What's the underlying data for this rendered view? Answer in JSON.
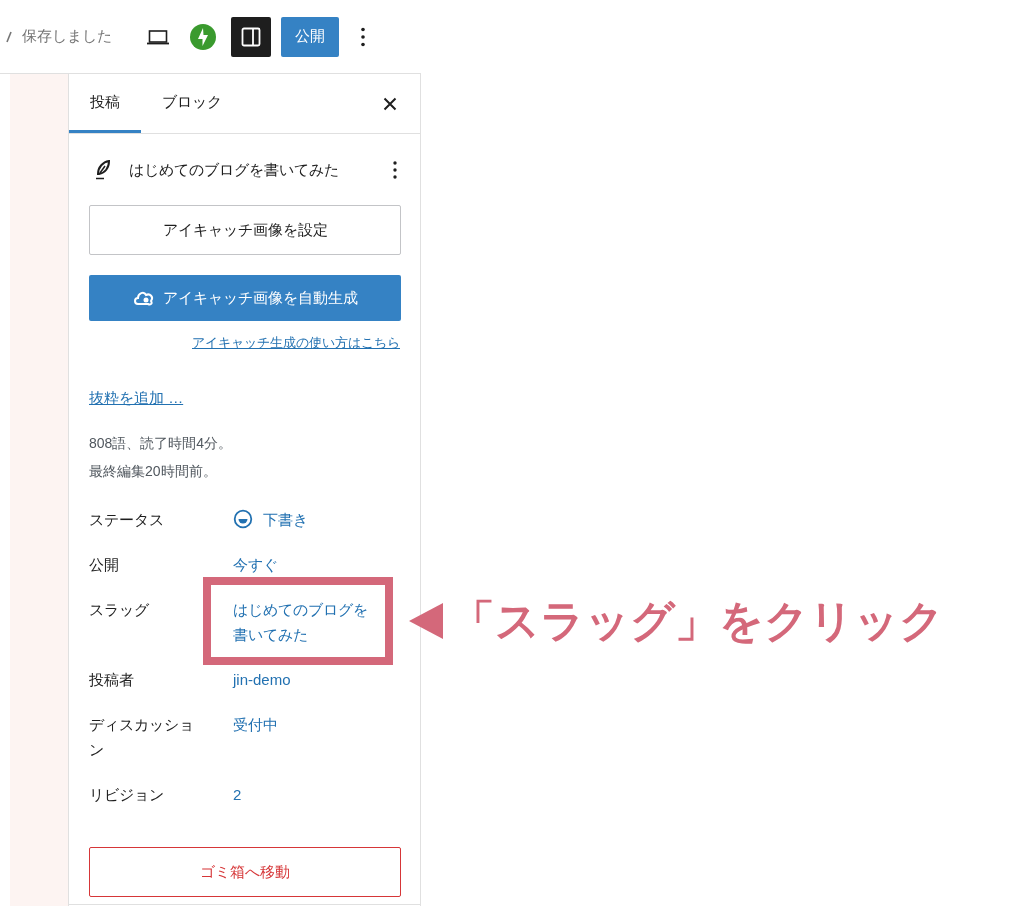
{
  "top_bar": {
    "save_status": "保存しました",
    "sidebar_toggle_pressed": true,
    "publish_button": "公開"
  },
  "sidebar": {
    "tabs": [
      {
        "label": "投稿",
        "selected": true
      },
      {
        "label": "ブロック",
        "selected": false
      }
    ],
    "post_title": "はじめてのブログを書いてみた",
    "featured_image_button": "アイキャッチ画像を設定",
    "auto_generate_button": "アイキャッチ画像を自動生成",
    "help_link": "アイキャッチ生成の使い方はこちら",
    "excerpt_link": "抜粋を追加 …",
    "stats": [
      "808語、読了時間4分。",
      "最終編集20時間前。"
    ],
    "fields": [
      {
        "kind": "status",
        "label": "ステータス",
        "value": "下書き",
        "highlight": false
      },
      {
        "kind": "link",
        "label": "公開",
        "value": "今すぐ",
        "highlight": false
      },
      {
        "kind": "link",
        "label": "スラッグ",
        "value": "はじめてのブログを書いてみた",
        "highlight": true
      },
      {
        "kind": "link",
        "label": "投稿者",
        "value": "jin-demo",
        "highlight": false
      },
      {
        "kind": "link",
        "label": "ディスカッション",
        "value": "受付中",
        "highlight": false
      },
      {
        "kind": "link",
        "label": "リビジョン",
        "value": "2",
        "highlight": false
      }
    ],
    "trash_button": "ゴミ箱へ移動"
  },
  "annotation": {
    "text": "「スラッグ」をクリック"
  }
}
